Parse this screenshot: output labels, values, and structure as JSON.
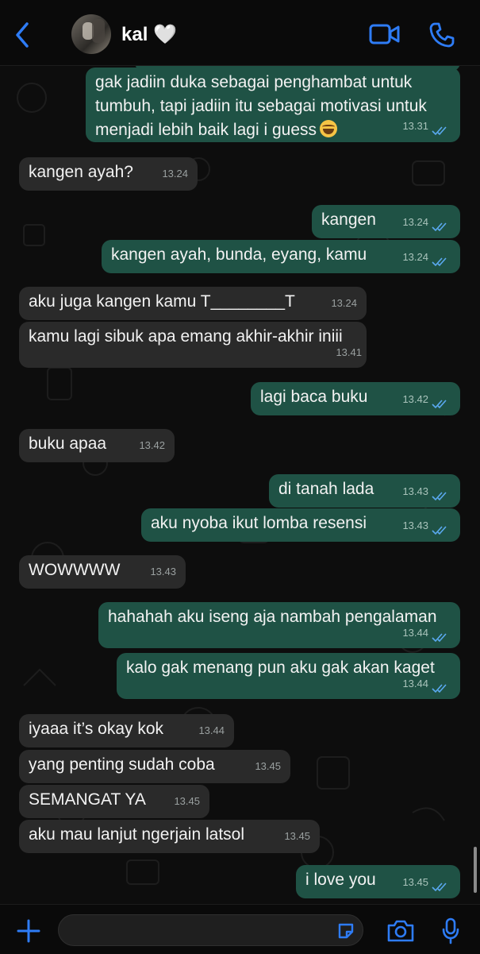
{
  "header": {
    "contact_name": "kal 🤍",
    "avatar_icon": "contact-avatar",
    "back_icon": "chevron-left-icon",
    "video_icon": "video-camera-icon",
    "call_icon": "phone-icon",
    "accent_color": "#2e7cf6"
  },
  "messages": [
    {
      "dir": "out",
      "text": "gak jadiin duka sebagai penghambat untuk tumbuh, tapi jadiin itu sebagai motivasi untuk menjadi lebih baik lagi i guess",
      "emoji": "😂",
      "time": "13.31",
      "read": true
    },
    {
      "dir": "in",
      "text": "kangen ayah?",
      "time": "13.24"
    },
    {
      "dir": "out",
      "text": "kangen",
      "time": "13.24",
      "read": true
    },
    {
      "dir": "out",
      "text": "kangen ayah, bunda, eyang, kamu",
      "time": "13.24",
      "read": true
    },
    {
      "dir": "in",
      "text": "aku juga kangen kamu T________T",
      "time": "13.24"
    },
    {
      "dir": "in",
      "text": "kamu lagi sibuk apa emang akhir-akhir iniii",
      "time": "13.41"
    },
    {
      "dir": "out",
      "text": "lagi baca buku",
      "time": "13.42",
      "read": true
    },
    {
      "dir": "in",
      "text": "buku apaa",
      "time": "13.42"
    },
    {
      "dir": "out",
      "text": "di tanah lada",
      "time": "13.43",
      "read": true
    },
    {
      "dir": "out",
      "text": "aku nyoba ikut lomba resensi",
      "time": "13.43",
      "read": true
    },
    {
      "dir": "in",
      "text": "WOWWWW",
      "time": "13.43"
    },
    {
      "dir": "out",
      "text": "hahahah aku iseng aja nambah pengalaman",
      "time": "13.44",
      "read": true
    },
    {
      "dir": "out",
      "text": "kalo gak menang pun aku gak akan kaget",
      "time": "13.44",
      "read": true
    },
    {
      "dir": "in",
      "text": "iyaaa it’s okay kok",
      "time": "13.44"
    },
    {
      "dir": "in",
      "text": "yang penting sudah coba",
      "time": "13.45"
    },
    {
      "dir": "in",
      "text": "SEMANGAT YA",
      "time": "13.45"
    },
    {
      "dir": "in",
      "text": "aku mau lanjut ngerjain latsol",
      "time": "13.45"
    },
    {
      "dir": "out",
      "text": "i love you",
      "time": "13.45",
      "read": true
    }
  ],
  "footer": {
    "plus_icon": "plus-icon",
    "message_value": "",
    "sticker_icon": "sticker-icon",
    "camera_icon": "camera-icon",
    "mic_icon": "microphone-icon"
  }
}
